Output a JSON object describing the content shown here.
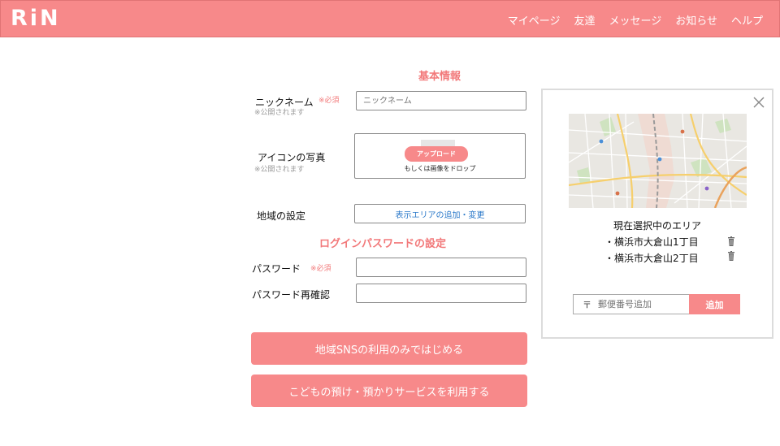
{
  "app": {
    "logo": "RiN"
  },
  "nav": {
    "items": [
      "マイページ",
      "友達",
      "メッセージ",
      "お知らせ",
      "ヘルプ"
    ]
  },
  "form": {
    "basic_title": "基本情報",
    "nickname": {
      "label": "ニックネーム",
      "required": "※必須",
      "note": "※公開されます",
      "placeholder": "ニックネーム"
    },
    "icon": {
      "label": "アイコンの写真",
      "note": "※公開されます",
      "upload_button": "アップロード",
      "drop_hint": "もしくは画像をドロップ"
    },
    "region": {
      "label": "地域の設定",
      "button": "表示エリアの追加・変更"
    },
    "password_title": "ログインパスワードの設定",
    "password": {
      "label": "パスワード",
      "required": "※必須",
      "value": ""
    },
    "password_confirm": {
      "label": "パスワード再確認",
      "value": ""
    },
    "actions": {
      "sns_button": "地域SNSの利用のみではじめる",
      "childcare_button": "こどもの預け・預かりサービスを利用する"
    }
  },
  "area_panel": {
    "title": "現在選択中のエリア",
    "areas": [
      "・横浜市大倉山1丁目",
      "・横浜市大倉山2丁目"
    ],
    "zip": {
      "mark": "〒",
      "placeholder": "郵便番号追加",
      "add_button": "追加"
    }
  },
  "colors": {
    "accent": "#f7898a",
    "accent_text": "#f2797a",
    "link": "#2a78c9"
  }
}
